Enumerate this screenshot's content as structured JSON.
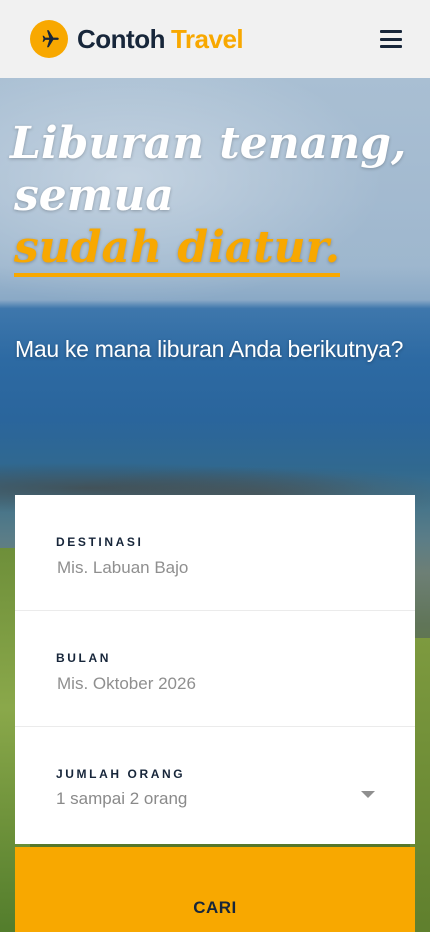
{
  "header": {
    "brand_primary": "Contoh",
    "brand_secondary": "Travel",
    "logo_icon": "airplane-icon",
    "menu_icon": "hamburger-menu-icon"
  },
  "hero": {
    "headline_line1": "Liburan tenang,",
    "headline_line2": "semua",
    "headline_accent": "sudah diatur.",
    "subheading": "Mau ke mana liburan Anda berikutnya?"
  },
  "search_form": {
    "destination": {
      "label": "DESTINASI",
      "placeholder": "Mis. Labuan Bajo"
    },
    "month": {
      "label": "BULAN",
      "placeholder": "Mis. Oktober 2026"
    },
    "people": {
      "label": "JUMLAH ORANG",
      "selected": "1 sampai 2 orang"
    },
    "submit_label": "CARI"
  },
  "colors": {
    "brand_orange": "#f8a800",
    "brand_navy": "#17263a"
  }
}
